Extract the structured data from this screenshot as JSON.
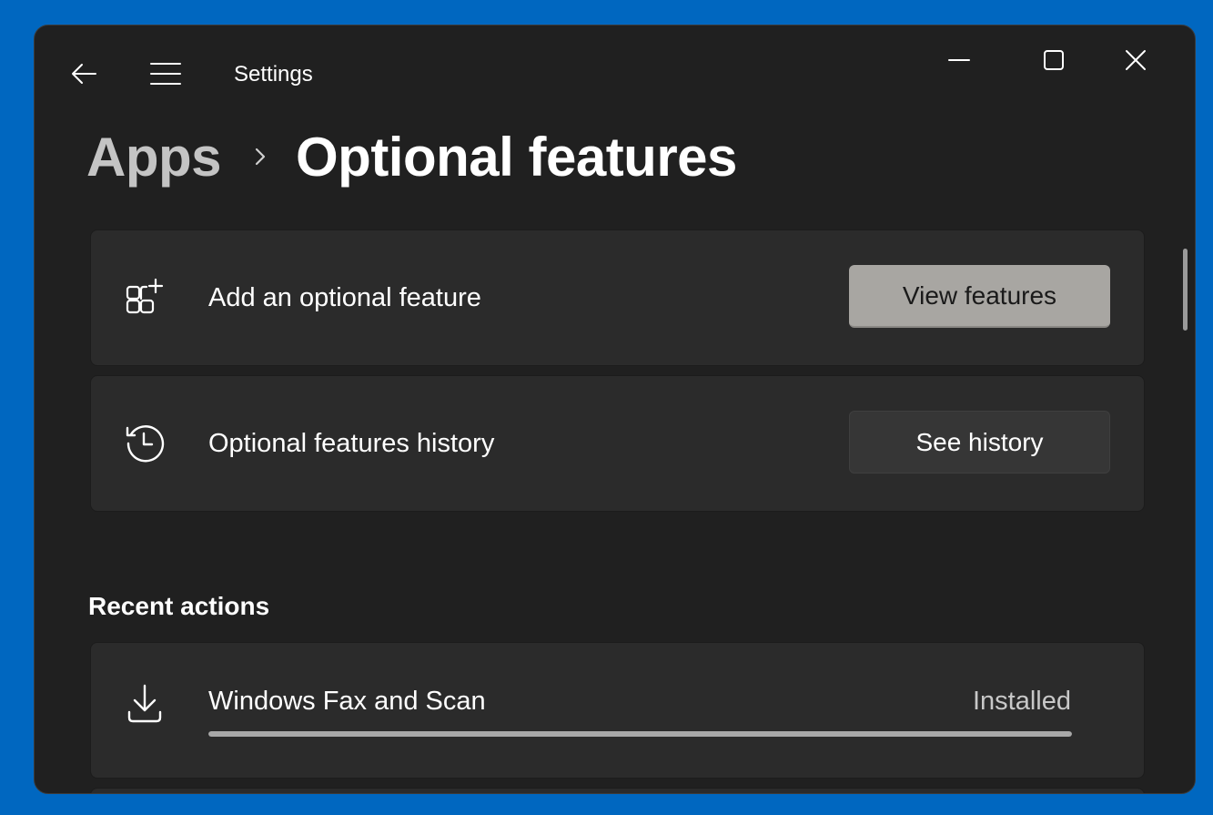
{
  "window": {
    "title": "Settings"
  },
  "icons": {
    "back": "back-arrow-icon",
    "menu": "hamburger-menu-icon",
    "minimize": "minimize-icon",
    "maximize": "maximize-icon",
    "close": "close-icon",
    "breadcrumb_separator": "chevron-right-icon",
    "add_feature": "add-apps-grid-icon",
    "history": "history-clock-icon",
    "download": "download-icon"
  },
  "breadcrumb": {
    "parent": "Apps",
    "current": "Optional features"
  },
  "cards": {
    "add_feature": {
      "label": "Add an optional feature",
      "button_label": "View features"
    },
    "history": {
      "label": "Optional features history",
      "button_label": "See history"
    }
  },
  "recent_actions": {
    "heading": "Recent actions",
    "items": [
      {
        "name": "Windows Fax and Scan",
        "status": "Installed",
        "progress": 1.0
      }
    ]
  },
  "colors": {
    "desktop_background": "#0067c0",
    "window_background": "#202020",
    "card_background": "#2b2b2b",
    "primary_button": "#a8a6a2",
    "progress_fill": "#a8a8a8"
  }
}
